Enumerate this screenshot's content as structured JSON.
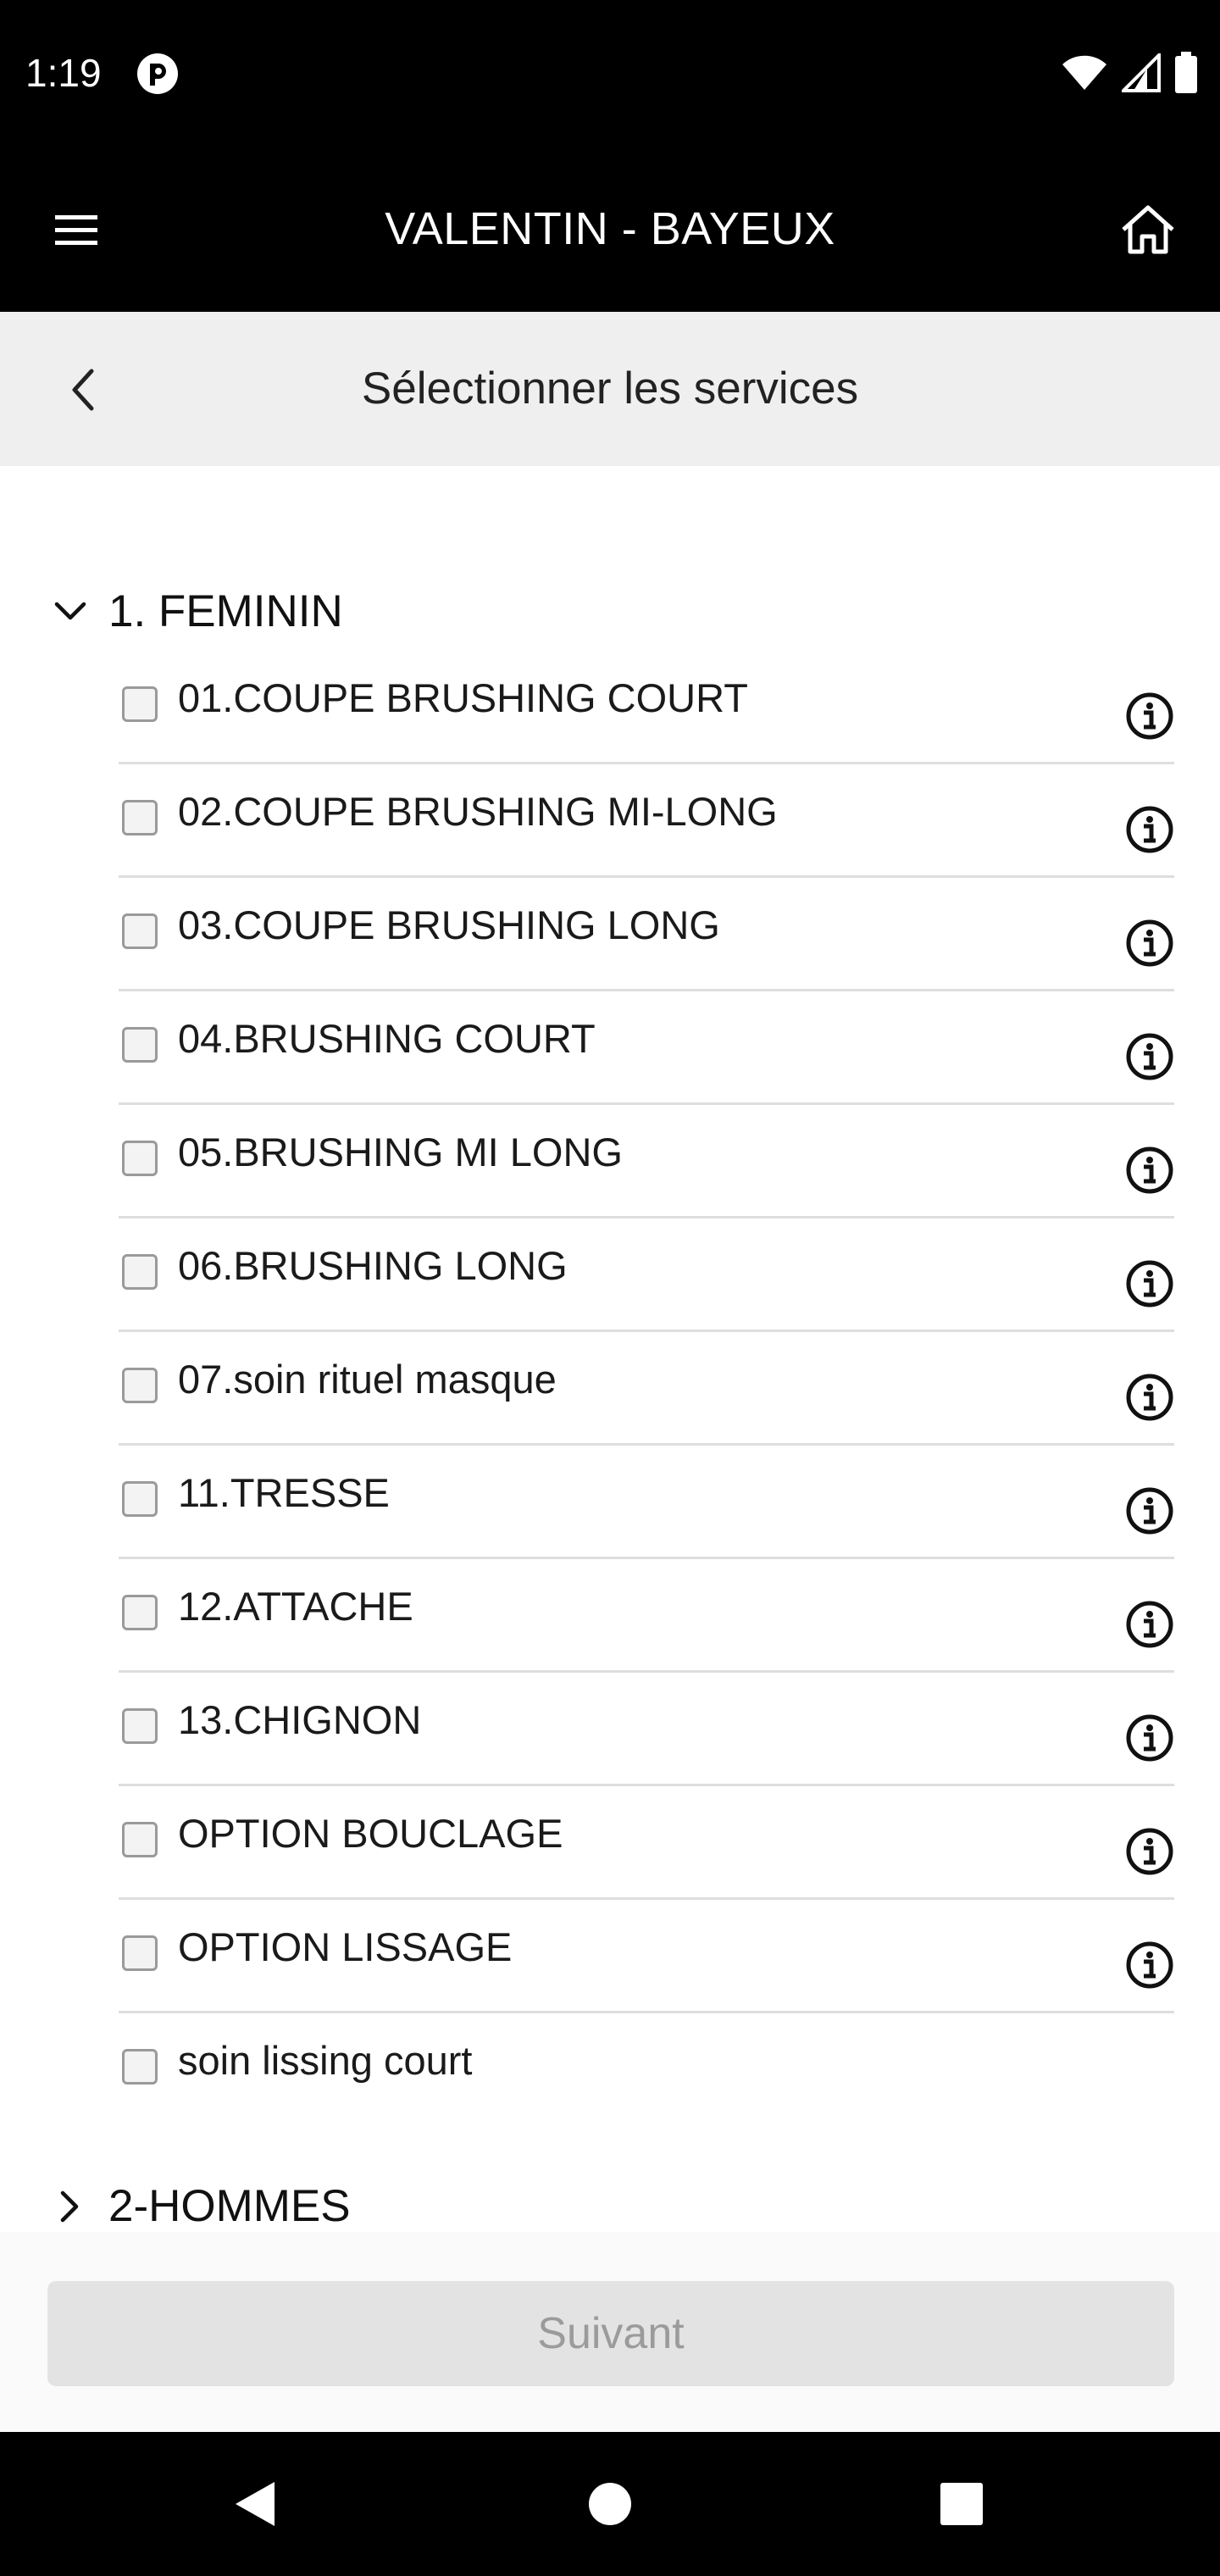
{
  "status_bar": {
    "time": "1:19",
    "icons": [
      "app-notification-icon",
      "wifi-icon",
      "signal-icon",
      "battery-icon"
    ]
  },
  "app_bar": {
    "title": "VALENTIN - BAYEUX",
    "icons": [
      "menu-icon",
      "home-icon"
    ]
  },
  "sub_header": {
    "title": "Sélectionner les services",
    "icon": "back-chevron-icon"
  },
  "categories": [
    {
      "label": "1. FEMININ",
      "expanded": true,
      "services": [
        {
          "label": "01.COUPE BRUSHING COURT",
          "checked": false,
          "has_info": true
        },
        {
          "label": "02.COUPE BRUSHING MI-LONG",
          "checked": false,
          "has_info": true
        },
        {
          "label": "03.COUPE BRUSHING LONG",
          "checked": false,
          "has_info": true
        },
        {
          "label": "04.BRUSHING COURT",
          "checked": false,
          "has_info": true
        },
        {
          "label": "05.BRUSHING MI LONG",
          "checked": false,
          "has_info": true
        },
        {
          "label": "06.BRUSHING LONG",
          "checked": false,
          "has_info": true
        },
        {
          "label": "07.soin rituel masque",
          "checked": false,
          "has_info": true
        },
        {
          "label": "11.TRESSE",
          "checked": false,
          "has_info": true
        },
        {
          "label": "12.ATTACHE",
          "checked": false,
          "has_info": true
        },
        {
          "label": "13.CHIGNON",
          "checked": false,
          "has_info": true
        },
        {
          "label": "OPTION BOUCLAGE",
          "checked": false,
          "has_info": true
        },
        {
          "label": "OPTION LISSAGE",
          "checked": false,
          "has_info": true
        },
        {
          "label": "soin lissing court",
          "checked": false,
          "has_info": false
        }
      ]
    },
    {
      "label": "2-HOMMES",
      "expanded": false,
      "services": []
    }
  ],
  "footer": {
    "next_label": "Suivant",
    "next_enabled": false
  },
  "colors": {
    "bar_background": "#000000",
    "sub_header_background": "#efefef",
    "disabled_button": "#e3e3e3",
    "disabled_text": "#9b9b9b"
  }
}
